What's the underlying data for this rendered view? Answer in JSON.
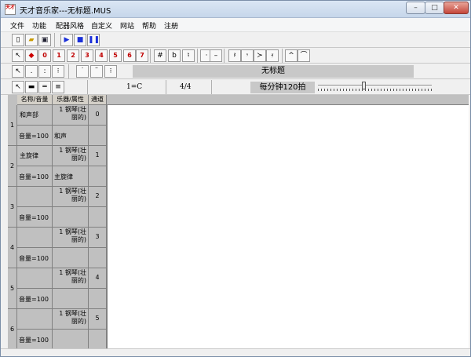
{
  "window": {
    "icon_text": "天才",
    "title": "天才音乐家---无标题.MUS"
  },
  "menu": [
    "文件",
    "功能",
    "配器风格",
    "自定义",
    "网站",
    "帮助",
    "注册"
  ],
  "toolbar1": {
    "numbers": [
      "0",
      "1",
      "2",
      "3",
      "4",
      "5",
      "6",
      "7"
    ],
    "accidentals": [
      "#",
      "b",
      "♮"
    ]
  },
  "toolbar2": {
    "score_title": "无标题"
  },
  "toolbar3": {
    "key": "1=C",
    "time_signature": "4/4",
    "tempo": "每分钟120拍",
    "tempo_value": 120
  },
  "table": {
    "headers": [
      "名称/音量",
      "乐器/属性",
      "通道"
    ],
    "tracks": [
      {
        "num": "1",
        "name": "和声部",
        "instrument": "1 钢琴(壮丽的)",
        "channel": "0",
        "volume": "音量=100",
        "attr": "和声"
      },
      {
        "num": "2",
        "name": "主旋律",
        "instrument": "1 钢琴(壮丽的)",
        "channel": "1",
        "volume": "音量=100",
        "attr": "主旋律"
      },
      {
        "num": "3",
        "name": "",
        "instrument": "1 钢琴(壮丽的)",
        "channel": "2",
        "volume": "音量=100",
        "attr": ""
      },
      {
        "num": "4",
        "name": "",
        "instrument": "1 钢琴(壮丽的)",
        "channel": "3",
        "volume": "音量=100",
        "attr": ""
      },
      {
        "num": "5",
        "name": "",
        "instrument": "1 钢琴(壮丽的)",
        "channel": "4",
        "volume": "音量=100",
        "attr": ""
      },
      {
        "num": "6",
        "name": "",
        "instrument": "1 钢琴(壮丽的)",
        "channel": "5",
        "volume": "音量=100",
        "attr": ""
      }
    ]
  }
}
